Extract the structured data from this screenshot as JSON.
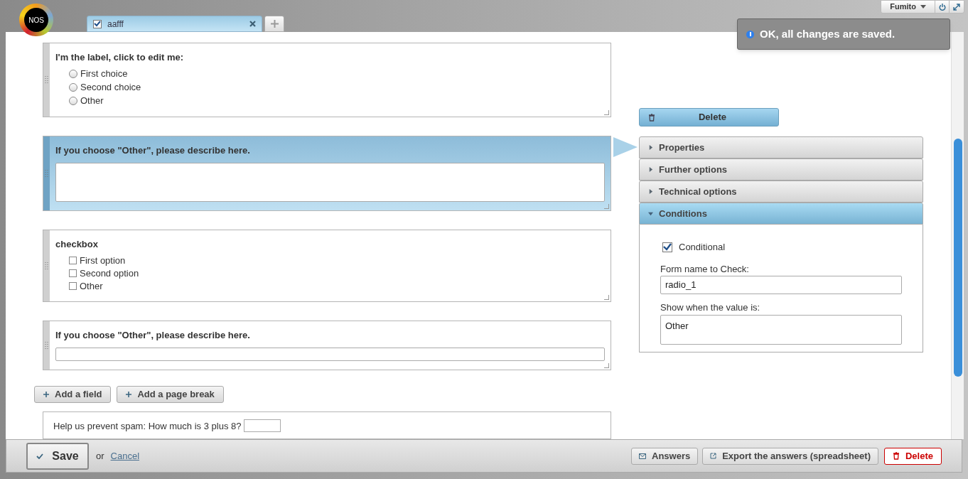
{
  "logo": {
    "text": "NOS"
  },
  "tabs": [
    {
      "label": "aafff",
      "checked": true,
      "selected": true
    }
  ],
  "user": {
    "name": "Fumito"
  },
  "toast": {
    "message": "OK, all changes are saved."
  },
  "fields": [
    {
      "kind": "radio",
      "label": "I'm the label, click to edit me:",
      "selected": false,
      "options": [
        {
          "label": "First choice",
          "checked": false
        },
        {
          "label": "Second choice",
          "checked": false
        },
        {
          "label": "Other",
          "checked": false
        }
      ]
    },
    {
      "kind": "textarea",
      "label": "If you choose \"Other\", please describe here.",
      "selected": true
    },
    {
      "kind": "checkbox",
      "label": "checkbox",
      "selected": false,
      "options": [
        {
          "label": "First option",
          "checked": false
        },
        {
          "label": "Second option",
          "checked": false
        },
        {
          "label": "Other",
          "checked": false
        }
      ]
    },
    {
      "kind": "input",
      "label": "If you choose \"Other\", please describe here.",
      "selected": false
    }
  ],
  "add_buttons": [
    "Add a field",
    "Add a page break"
  ],
  "spam": {
    "question": "Help us prevent spam: How much is 3 plus 8?"
  },
  "panel": {
    "delete": "Delete",
    "sections": [
      {
        "label": "Properties",
        "expanded": false
      },
      {
        "label": "Further options",
        "expanded": false
      },
      {
        "label": "Technical options",
        "expanded": false
      },
      {
        "label": "Conditions",
        "expanded": true
      }
    ],
    "conditional": {
      "label": "Conditional",
      "checked": true
    },
    "form_name_label": "Form name to Check:",
    "form_name_value": "radio_1",
    "value_label": "Show when the value is:",
    "value_value": "Other"
  },
  "footer": {
    "save": "Save",
    "or": "or",
    "cancel": "Cancel",
    "answers": "Answers",
    "export": "Export the answers (spreadsheet)",
    "delete": "Delete"
  }
}
